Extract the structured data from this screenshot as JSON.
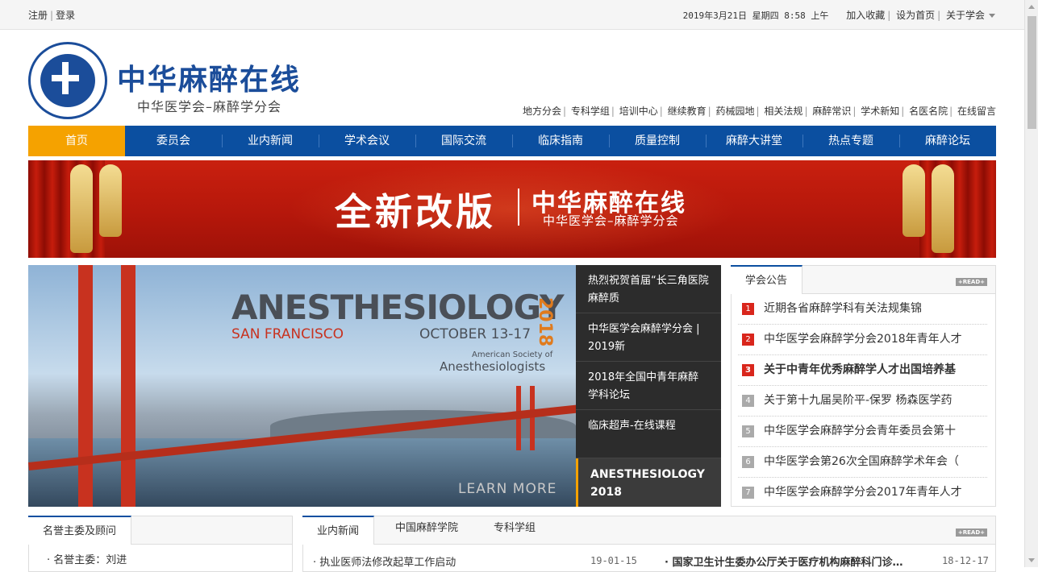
{
  "topbar": {
    "register": "注册",
    "login": "登录",
    "datetime": "2019年3月21日 星期四 8:58 上午",
    "favorite": "加入收藏",
    "homepage": "设为首页",
    "about": "关于学会"
  },
  "header": {
    "title": "中华麻醉在线",
    "subtitle": "中华医学会–麻醉学分会",
    "quick_links": [
      "地方分会",
      "专科学组",
      "培训中心",
      "继续教育",
      "药械园地",
      "相关法规",
      "麻醉常识",
      "学术新知",
      "名医名院",
      "在线留言"
    ]
  },
  "nav": [
    "首页",
    "委员会",
    "业内新闻",
    "学术会议",
    "国际交流",
    "临床指南",
    "质量控制",
    "麻醉大讲堂",
    "热点专题",
    "麻醉论坛"
  ],
  "banner": {
    "main": "全新改版",
    "title": "中华麻醉在线",
    "subtitle": "中华医学会–麻醉学分会"
  },
  "slide": {
    "title": "ANESTHESIOLOGY",
    "year": "2018",
    "city": "SAN FRANCISCO",
    "dates": "OCTOBER 13-17",
    "asa_line1": "American Society of",
    "asa_line2": "Anesthesiologists",
    "learn_more": "LEARN MORE"
  },
  "slide_list": [
    "热烈祝贺首届“长三角医院麻醉质",
    "中华医学会麻醉学分会 | 2019新",
    "2018年全国中青年麻醉学科论坛",
    "临床超声-在线课程",
    "ANESTHESIOLOGY 2018"
  ],
  "notice": {
    "tab": "学会公告",
    "more": "+READ+",
    "items": [
      {
        "rank": "1",
        "text": "近期各省麻醉学科有关法规集锦"
      },
      {
        "rank": "2",
        "text": "中华医学会麻醉学分会2018年青年人才"
      },
      {
        "rank": "3",
        "text": "关于中青年优秀麻醉学人才出国培养基"
      },
      {
        "rank": "4",
        "text": "关于第十九届吴阶平-保罗 杨森医学药"
      },
      {
        "rank": "5",
        "text": "中华医学会麻醉学分会青年委员会第十"
      },
      {
        "rank": "6",
        "text": "中华医学会第26次全国麻醉学术年会（"
      },
      {
        "rank": "7",
        "text": "中华医学会麻醉学分会2017年青年人才"
      }
    ]
  },
  "honor": {
    "tab": "名誉主委及顾问",
    "item": "· 名誉主委：刘进"
  },
  "news": {
    "tabs": [
      "业内新闻",
      "中国麻醉学院",
      "专科学组"
    ],
    "more": "+READ+",
    "left": {
      "title": "· 执业医师法修改起草工作启动",
      "date": "19-01-15"
    },
    "right": {
      "title": "· 国家卫生计生委办公厅关于医疗机构麻醉科门诊…",
      "date": "18-12-17"
    }
  }
}
